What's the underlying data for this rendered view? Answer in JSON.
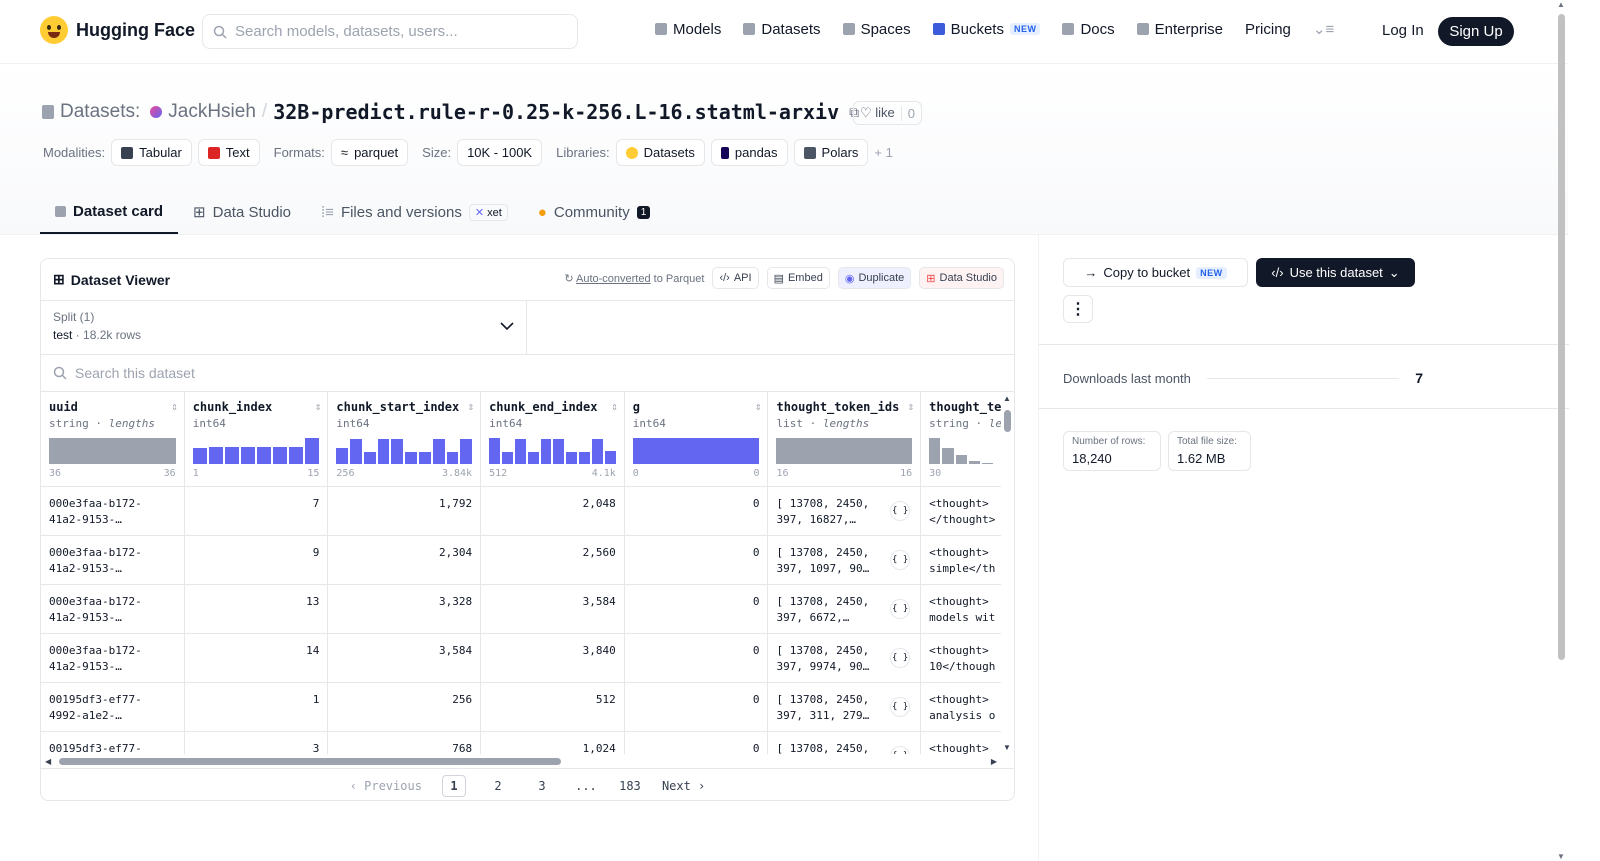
{
  "nav": {
    "brand": "Hugging Face",
    "search_placeholder": "Search models, datasets, users...",
    "links": [
      "Models",
      "Datasets",
      "Spaces",
      "Buckets",
      "Docs",
      "Enterprise",
      "Pricing"
    ],
    "new_badge": "NEW",
    "login": "Log In",
    "signup": "Sign Up"
  },
  "header": {
    "prefix": "Datasets:",
    "owner": "JackHsieh",
    "slash": "/",
    "repo": "32B-predict.rule-r-0.25-k-256.L-16.statml-arxiv",
    "like_label": "like",
    "like_count": "0",
    "modalities_label": "Modalities:",
    "modalities": [
      "Tabular",
      "Text"
    ],
    "formats_label": "Formats:",
    "format": "parquet",
    "size_label": "Size:",
    "size": "10K - 100K",
    "libraries_label": "Libraries:",
    "libraries": [
      "Datasets",
      "pandas",
      "Polars"
    ],
    "more_libraries": "+ 1"
  },
  "tabs": {
    "card": "Dataset card",
    "studio": "Data Studio",
    "files": "Files and versions",
    "xet": "xet",
    "community": "Community",
    "community_count": "1"
  },
  "viewer": {
    "title": "Dataset Viewer",
    "auto_converted": "Auto-converted",
    "to_parquet": "to Parquet",
    "api": "API",
    "embed": "Embed",
    "duplicate": "Duplicate",
    "data_studio": "Data Studio",
    "split_label": "Split (1)",
    "split_value": "test",
    "split_rows": "18.2k rows",
    "search_placeholder": "Search this dataset",
    "columns": [
      {
        "name": "uuid",
        "type": "string",
        "type2": "lengths",
        "min": "36",
        "max": "36"
      },
      {
        "name": "chunk_index",
        "type": "int64",
        "type2": "",
        "min": "1",
        "max": "15"
      },
      {
        "name": "chunk_start_index",
        "type": "int64",
        "type2": "",
        "min": "256",
        "max": "3.84k"
      },
      {
        "name": "chunk_end_index",
        "type": "int64",
        "type2": "",
        "min": "512",
        "max": "4.1k"
      },
      {
        "name": "g",
        "type": "int64",
        "type2": "",
        "min": "0",
        "max": "0"
      },
      {
        "name": "thought_token_ids",
        "type": "list",
        "type2": "lengths",
        "min": "16",
        "max": "16"
      },
      {
        "name": "thought_te",
        "type": "string",
        "type2": "le",
        "min": "30",
        "max": ""
      }
    ],
    "rows": [
      {
        "uuid": "000e3faa-b172-",
        "uuid2": "41a2-9153-…",
        "ci": "7",
        "cs": "1,792",
        "ce": "2,048",
        "g": "0",
        "t1": "[ 13708, 2450,",
        "t2": "397, 16827,…",
        "x1": "<thought>",
        "x2": "</thought>"
      },
      {
        "uuid": "000e3faa-b172-",
        "uuid2": "41a2-9153-…",
        "ci": "9",
        "cs": "2,304",
        "ce": "2,560",
        "g": "0",
        "t1": "[ 13708, 2450,",
        "t2": "397, 1097, 90…",
        "x1": "<thought>",
        "x2": "simple</th"
      },
      {
        "uuid": "000e3faa-b172-",
        "uuid2": "41a2-9153-…",
        "ci": "13",
        "cs": "3,328",
        "ce": "3,584",
        "g": "0",
        "t1": "[ 13708, 2450,",
        "t2": "397, 6672,…",
        "x1": "<thought>",
        "x2": "models wit"
      },
      {
        "uuid": "000e3faa-b172-",
        "uuid2": "41a2-9153-…",
        "ci": "14",
        "cs": "3,584",
        "ce": "3,840",
        "g": "0",
        "t1": "[ 13708, 2450,",
        "t2": "397, 9974, 90…",
        "x1": "<thought>",
        "x2": "10</though"
      },
      {
        "uuid": "00195df3-ef77-",
        "uuid2": "4992-a1e2-…",
        "ci": "1",
        "cs": "256",
        "ce": "512",
        "g": "0",
        "t1": "[ 13708, 2450,",
        "t2": "397, 311, 279…",
        "x1": "<thought>",
        "x2": "analysis o"
      },
      {
        "uuid": "00195df3-ef77-",
        "uuid2": "",
        "ci": "3",
        "cs": "768",
        "ce": "1,024",
        "g": "0",
        "t1": "[ 13708, 2450,",
        "t2": "",
        "x1": "<thought>",
        "x2": ""
      }
    ],
    "json_icon": "{ }",
    "pager": {
      "prev": "‹ Previous",
      "pages": [
        "1",
        "2",
        "3",
        "...",
        "183"
      ],
      "next": "Next ›"
    }
  },
  "sidebar": {
    "copy_bucket": "Copy to bucket",
    "new_badge": "NEW",
    "use_dataset": "Use this dataset",
    "more": "⋮",
    "downloads_label": "Downloads last month",
    "downloads_value": "7",
    "rows_label": "Number of rows:",
    "rows_value": "18,240",
    "size_label": "Total file size:",
    "size_value": "1.62 MB"
  },
  "colors": {
    "accent": "#6366f1",
    "dark": "#111827",
    "muted": "#6b7280"
  }
}
